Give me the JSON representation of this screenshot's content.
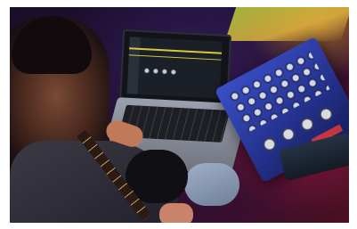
{
  "scene": {
    "alt": "",
    "subjects": [
      "person-playing-bass",
      "laptop",
      "multi-effects-pedal-board",
      "expression-pedal"
    ],
    "colors": {
      "background": "#231236",
      "pedal_blue": "#3a4fc8",
      "accent_red": "#c21e46",
      "lamp_yellow": "#d4c93a"
    }
  }
}
